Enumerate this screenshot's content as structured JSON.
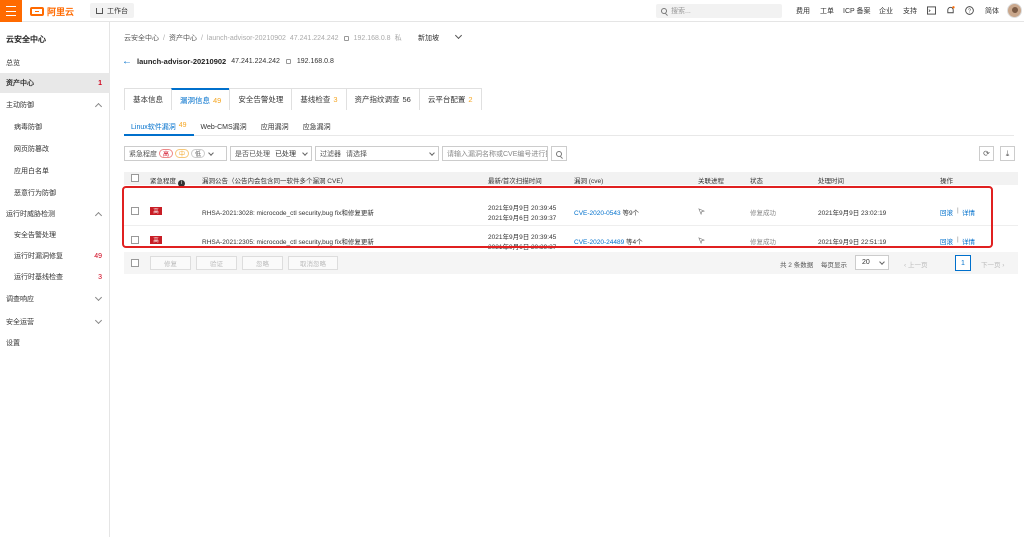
{
  "topbar": {
    "brand": "阿里云",
    "workbench": "工作台",
    "search_placeholder": "搜索...",
    "nav": [
      "费用",
      "工单",
      "ICP 备案",
      "企业",
      "支持"
    ],
    "user": "简体"
  },
  "sidebar": {
    "title": "云安全中心",
    "items": [
      {
        "label": "总览"
      },
      {
        "label": "资产中心",
        "badge": "1"
      },
      {
        "label": "主动防御"
      },
      {
        "label": "病毒防御"
      },
      {
        "label": "网页防篡改"
      },
      {
        "label": "应用白名单"
      },
      {
        "label": "恶意行为防御"
      },
      {
        "label": "运行时威胁检测"
      },
      {
        "label": "安全告警处理"
      },
      {
        "label": "运行时漏洞修复",
        "badge": "49"
      },
      {
        "label": "运行时基线检查",
        "badge": "3"
      },
      {
        "label": "调查响应"
      },
      {
        "label": "安全运营"
      },
      {
        "label": "设置"
      }
    ]
  },
  "breadcrumb": {
    "items": [
      "云安全中心",
      "资产中心",
      "launch-advisor-20210902"
    ],
    "ip_public": "47.241.224.242",
    "ip_private": "192.168.0.8",
    "net_tag": "私",
    "add_reinforce": "新加坡"
  },
  "header": {
    "name": "launch-advisor-20210902",
    "ip_public": "47.241.224.242",
    "ip_private": "192.168.0.8"
  },
  "tabs": [
    {
      "label": "基本信息",
      "count": ""
    },
    {
      "label": "漏洞信息",
      "count": "49"
    },
    {
      "label": "安全告警处理",
      "count": ""
    },
    {
      "label": "基线检查",
      "count": "3"
    },
    {
      "label": "资产指纹调查",
      "count": "56"
    },
    {
      "label": "云平台配置",
      "count": "2"
    }
  ],
  "subtabs": [
    {
      "label": "Linux软件漏洞",
      "count": "49"
    },
    {
      "label": "Web-CMS漏洞",
      "count": ""
    },
    {
      "label": "应用漏洞",
      "count": ""
    },
    {
      "label": "应急漏洞",
      "count": ""
    }
  ],
  "filters": {
    "severity_label": "紧急程度",
    "sev_high": "高",
    "sev_mid": "中",
    "sev_low": "低",
    "status_label": "是否已处理",
    "status_value": "已处理",
    "filter_label": "过滤器",
    "filter_value": "请选择",
    "search_placeholder": "请输入漏洞名称或CVE编号进行搜索"
  },
  "table": {
    "headers": {
      "severity": "紧急程度",
      "bulletin": "漏洞公告（公告内会包含同一软件多个漏洞 CVE）",
      "scan_time": "最新/首次扫描时间",
      "cve": "漏洞 (cve)",
      "process": "关联进程",
      "status": "状态",
      "handle_time": "处理时间",
      "actions": "操作"
    },
    "rows": [
      {
        "severity": "高",
        "bulletin": "RHSA-2021:3028: microcode_ctl security,bug fix和修复更新",
        "scan_latest": "2021年9月9日 20:39:45",
        "scan_first": "2021年9月6日 20:39:37",
        "cve": "CVE-2020-0543",
        "cve_more": "等9个",
        "status": "修复成功",
        "handle_time": "2021年9月9日 23:02:19",
        "action_rollback": "回滚",
        "action_detail": "详情"
      },
      {
        "severity": "高",
        "bulletin": "RHSA-2021:2305: microcode_ctl security,bug fix和修复更新",
        "scan_latest": "2021年9月9日 20:39:45",
        "scan_first": "2021年9月6日 20:39:37",
        "cve": "CVE-2020-24489",
        "cve_more": "等4个",
        "status": "修复成功",
        "handle_time": "2021年9月9日 22:51:19",
        "action_rollback": "回滚",
        "action_detail": "详情"
      }
    ]
  },
  "footer": {
    "buttons": [
      "修复",
      "验证",
      "忽略",
      "取消忽略"
    ],
    "total": "共 2 条数据",
    "page_size_label": "每页显示",
    "page_size": "20",
    "prev": "上一页",
    "page": "1",
    "next": "下一页"
  }
}
